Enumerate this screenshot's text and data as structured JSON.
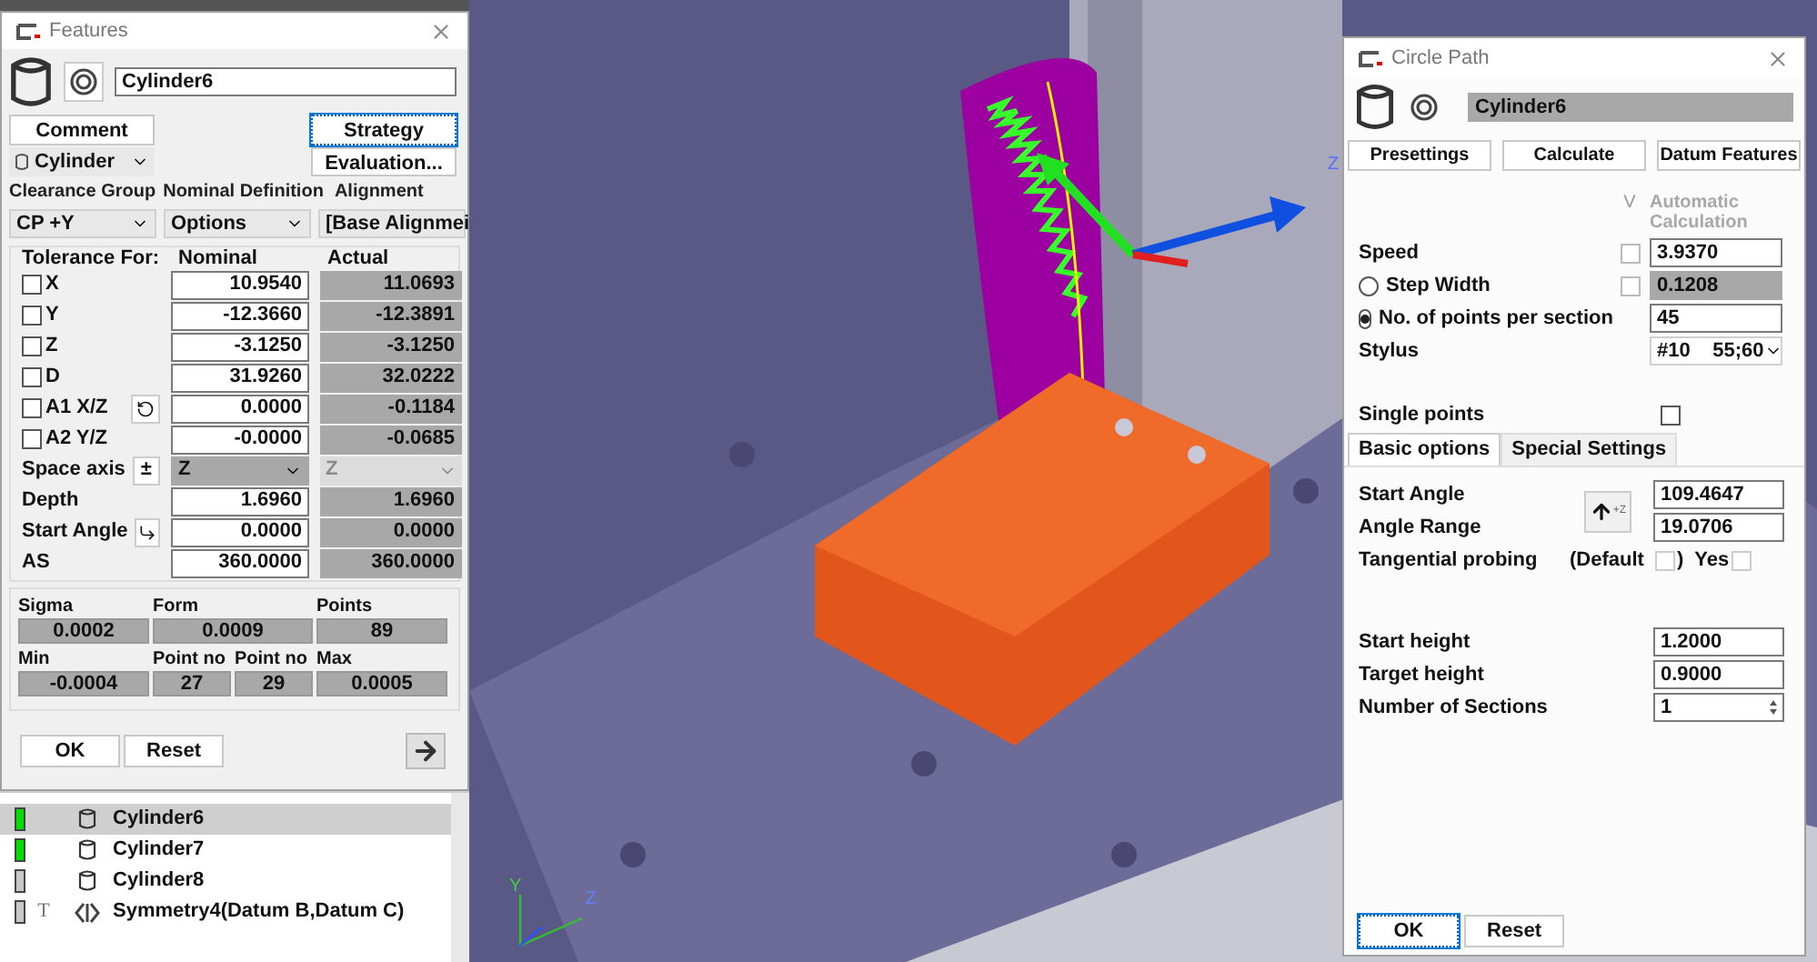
{
  "features_dialog": {
    "title": "Features",
    "name_value": "Cylinder6",
    "comment_button": "Comment",
    "strategy_button": {
      "label": "Strategy",
      "focused": true
    },
    "type_select": "Cylinder",
    "evaluation_button": "Evaluation...",
    "headers": [
      "Clearance Group",
      "Nominal Definition",
      "Alignment"
    ],
    "selects": [
      "CP +Y",
      "Options",
      "[Base Alignmei"
    ],
    "columns": [
      "Tolerance For:",
      "Nominal",
      "Actual"
    ],
    "rows": [
      {
        "kind": "check",
        "label": "X",
        "checked": false,
        "nominal": "10.9540",
        "actual": "11.0693"
      },
      {
        "kind": "check",
        "label": "Y",
        "checked": false,
        "nominal": "-12.3660",
        "actual": "-12.3891"
      },
      {
        "kind": "check",
        "label": "Z",
        "checked": false,
        "nominal": "-3.1250",
        "actual": "-3.1250"
      },
      {
        "kind": "check",
        "label": "D",
        "checked": false,
        "nominal": "31.9260",
        "actual": "32.0222"
      },
      {
        "kind": "check",
        "label": "A1 X/Z",
        "checked": false,
        "tool": {
          "kind": "rotate"
        },
        "nominal": "0.0000",
        "actual": "-0.1184"
      },
      {
        "kind": "check",
        "label": "A2 Y/Z",
        "checked": false,
        "nominal": "-0.0000",
        "actual": "-0.0685"
      },
      {
        "kind": "combo",
        "label": "Space axis",
        "tool": {
          "kind": "text",
          "text": "±"
        },
        "nominal": "Z",
        "actual": "Z",
        "actual_disabled": true
      },
      {
        "kind": "plain",
        "label": "Depth",
        "nominal": "1.6960",
        "actual": "1.6960"
      },
      {
        "kind": "plain",
        "label": "Start Angle",
        "tool": {
          "kind": "angle"
        },
        "nominal": "0.0000",
        "actual": "0.0000"
      },
      {
        "kind": "plain",
        "label": "AS",
        "nominal": "360.0000",
        "actual": "360.0000"
      }
    ],
    "stats": [
      {
        "kind": "wide",
        "label": "Sigma",
        "value": "0.0002"
      },
      {
        "kind": "wide",
        "label": "Form",
        "value": "0.0009"
      },
      {
        "kind": "wide",
        "label": "Points",
        "value": "89"
      },
      {
        "kind": "wide",
        "label": "Min",
        "value": "-0.0004"
      },
      {
        "kind": "narrow",
        "label": "Point no",
        "value": "27"
      },
      {
        "kind": "narrow",
        "label": "Point no",
        "value": "29"
      },
      {
        "kind": "wide",
        "label": "Max",
        "value": "0.0005"
      }
    ],
    "ok_button": "OK",
    "reset_button": "Reset"
  },
  "tree": [
    {
      "kind": "cylinder",
      "label": "Cylinder6",
      "selected": true,
      "color": "#00e000"
    },
    {
      "kind": "cylinder",
      "label": "Cylinder7",
      "selected": false,
      "color": "#00e000"
    },
    {
      "kind": "cylinder",
      "label": "Cylinder8",
      "selected": false,
      "color": "#c8c8c8"
    },
    {
      "kind": "symmetry",
      "label": "Symmetry4(Datum B,Datum C)",
      "selected": false,
      "color": "#c8c8c8",
      "flag": "T"
    }
  ],
  "viewport": {
    "axis_labels": [
      "Y",
      "Z"
    ],
    "side_label": "Z"
  },
  "circle_path_dialog": {
    "title": "Circle Path",
    "name_value": "Cylinder6",
    "buttons": [
      "Presettings",
      "Calculate",
      "Datum Features"
    ],
    "v_label": "V",
    "auto_label": "Automatic Calculation",
    "params": [
      {
        "kind": "field",
        "label": "Speed",
        "value": "3.9370",
        "v_checked": false
      },
      {
        "kind": "radio",
        "label": "Step Width",
        "selected": false,
        "value": "0.1208",
        "v_checked": false
      },
      {
        "kind": "radio",
        "label": "No. of points per section",
        "selected": true,
        "value": "45"
      },
      {
        "kind": "select",
        "label": "Stylus",
        "value": "#10    55;60"
      }
    ],
    "single_points": {
      "label": "Single points",
      "checked": false
    },
    "tabs": [
      {
        "label": "Basic options",
        "selected": true
      },
      {
        "label": "Special Settings",
        "selected": false
      }
    ],
    "start_angle": {
      "label": "Start Angle",
      "value": "109.4647"
    },
    "angle_range": {
      "label": "Angle Range",
      "value": "19.0706"
    },
    "direction_text": "+Z",
    "tangential": {
      "label": "Tangential probing",
      "default_text": "(Default",
      "close_text": ")",
      "yes_text": "Yes",
      "default_checked": false,
      "yes_checked": false
    },
    "heights": [
      {
        "kind": "field",
        "label": "Start height",
        "value": "1.2000"
      },
      {
        "kind": "field",
        "label": "Target height",
        "value": "0.9000"
      },
      {
        "kind": "spinner",
        "label": "Number of Sections",
        "value": "1"
      }
    ],
    "ok_button": "OK",
    "reset_button": "Reset"
  }
}
